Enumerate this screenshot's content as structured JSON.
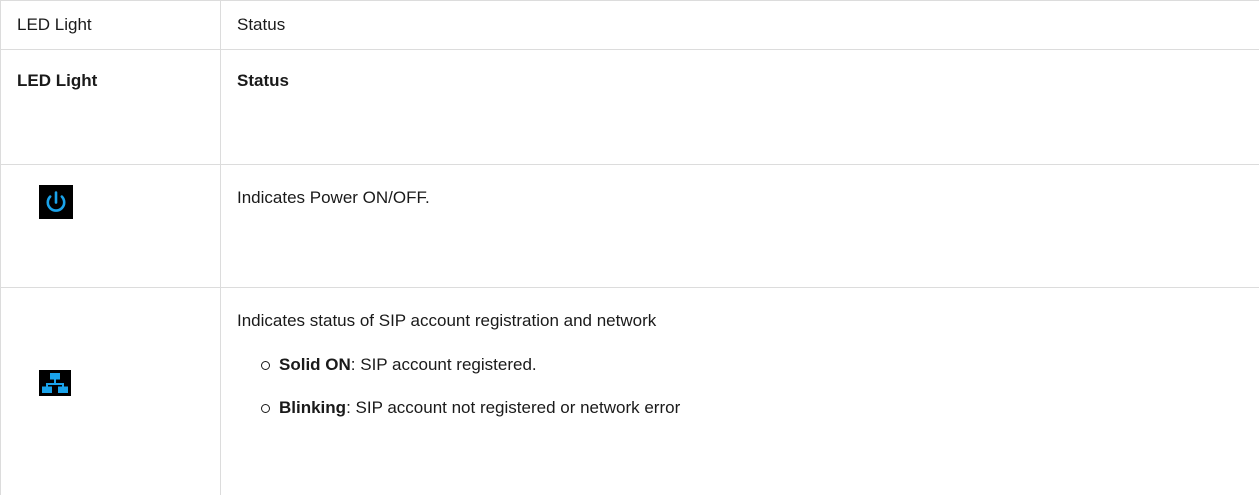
{
  "table": {
    "header": {
      "col1": "LED Light",
      "col2": "Status"
    },
    "subheader": {
      "col1": "LED Light",
      "col2": "Status"
    },
    "rows": [
      {
        "icon": "power-icon",
        "description": "Indicates Power ON/OFF."
      },
      {
        "icon": "network-icon",
        "description": "Indicates status of SIP account registration and network",
        "items": [
          {
            "term": "Solid ON",
            "text": ": SIP account registered."
          },
          {
            "term": "Blinking",
            "text": ": SIP account not registered or network error"
          }
        ]
      }
    ]
  },
  "colors": {
    "icon_background": "#000000",
    "icon_accent": "#1aa3ea",
    "border": "#dcdcdc"
  }
}
